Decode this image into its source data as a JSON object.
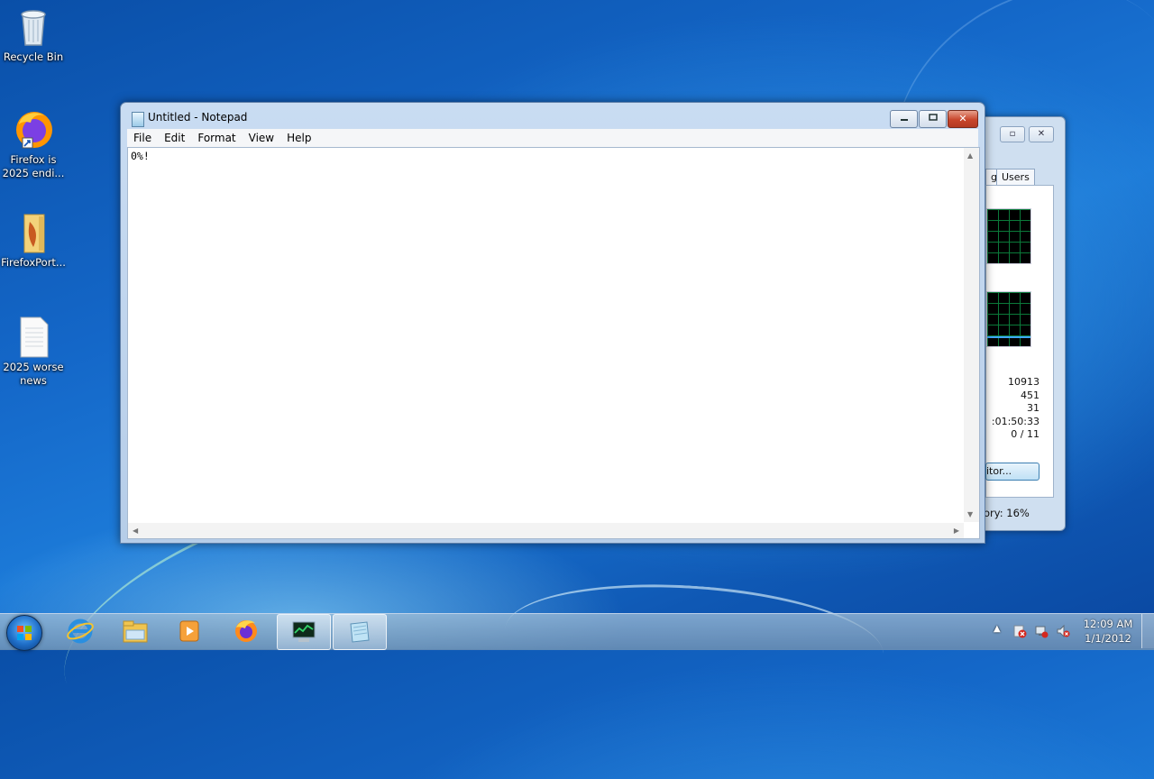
{
  "desktop": {
    "icons": [
      {
        "label": "Recycle Bin",
        "icon": "recycle-bin-icon"
      },
      {
        "label": "Firefox is 2025 endi...",
        "icon": "firefox-shortcut-icon"
      },
      {
        "label": "FirefoxPort...",
        "icon": "folder-icon"
      },
      {
        "label": "2025 worse news",
        "icon": "text-document-icon"
      }
    ]
  },
  "notepad": {
    "title": "Untitled - Notepad",
    "menu": [
      "File",
      "Edit",
      "Format",
      "View",
      "Help"
    ],
    "content": "0%!",
    "controls": {
      "minimize": "minimize-icon",
      "maximize": "maximize-icon",
      "close": "close-icon"
    }
  },
  "task_manager": {
    "tab_partial": "g",
    "tab_users": "Users",
    "stats": [
      "10913",
      "451",
      "31",
      ":01:50:33",
      "0 / 11"
    ],
    "monitor_button": "itor...",
    "status": "ory: 16%"
  },
  "taskbar": {
    "pinned": [
      "internet-explorer-icon",
      "windows-explorer-icon",
      "media-player-icon",
      "firefox-icon",
      "task-manager-icon",
      "notepad-icon"
    ],
    "tray_icons": [
      "show-hidden-icons-arrow",
      "action-center-icon",
      "network-icon",
      "volume-muted-icon"
    ],
    "clock": {
      "time": "12:09 AM",
      "date": "1/1/2012"
    }
  },
  "colors": {
    "accent": "#1467c8",
    "close_red": "#c8452b"
  }
}
